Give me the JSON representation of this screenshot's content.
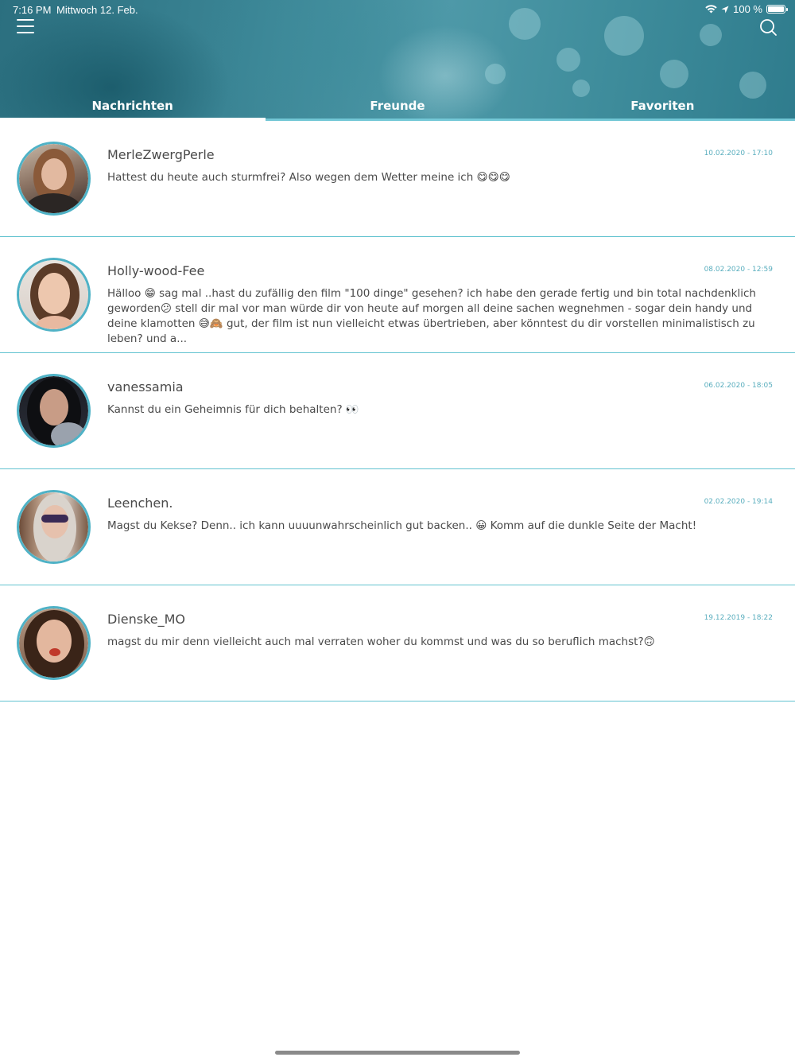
{
  "status_bar": {
    "time": "7:16 PM",
    "date": "Mittwoch 12. Feb.",
    "battery": "100 %",
    "icons": [
      "wifi-icon",
      "location-arrow-icon",
      "battery-icon"
    ]
  },
  "header": {
    "menu_icon": "hamburger-menu-icon",
    "search_icon": "search-icon",
    "tabs": [
      {
        "label": "Nachrichten",
        "active": true
      },
      {
        "label": "Freunde",
        "active": false
      },
      {
        "label": "Favoriten",
        "active": false
      }
    ]
  },
  "colors": {
    "accent": "#4fb2c6",
    "divider": "#62c3d0",
    "timestamp": "#5aaebe",
    "text": "#4a4a4a"
  },
  "messages": [
    {
      "name": "MerleZwergPerle",
      "time": "10.02.2020 - 17:10",
      "text": "Hattest du heute auch sturmfrei? Also wegen dem Wetter meine ich 😋😋😋"
    },
    {
      "name": "Holly-wood-Fee",
      "time": "08.02.2020 - 12:59",
      "text": "Hälloo 😁 sag mal ..hast du zufällig den film \"100 dinge\" gesehen? ich habe den gerade fertig und bin total nachdenklich geworden😕 stell dir mal vor man würde dir von heute auf morgen all deine sachen wegnehmen - sogar dein handy und deine klamotten 😅🙈 gut, der film ist nun vielleicht etwas übertrieben, aber könntest du dir vorstellen minimalistisch zu leben? und a..."
    },
    {
      "name": "vanessamia",
      "time": "06.02.2020 - 18:05",
      "text": "Kannst du ein Geheimnis für dich behalten? 👀"
    },
    {
      "name": "Leenchen.",
      "time": "02.02.2020 - 19:14",
      "text": "Magst du Kekse? Denn.. ich kann uuuunwahrscheinlich gut backen.. 😀 Komm auf die dunkle Seite der Macht!"
    },
    {
      "name": "Dienske_MO",
      "time": "19.12.2019 - 18:22",
      "text": "magst du mir denn vielleicht auch mal verraten woher du kommst und was du so beruflich machst?🙃"
    }
  ]
}
